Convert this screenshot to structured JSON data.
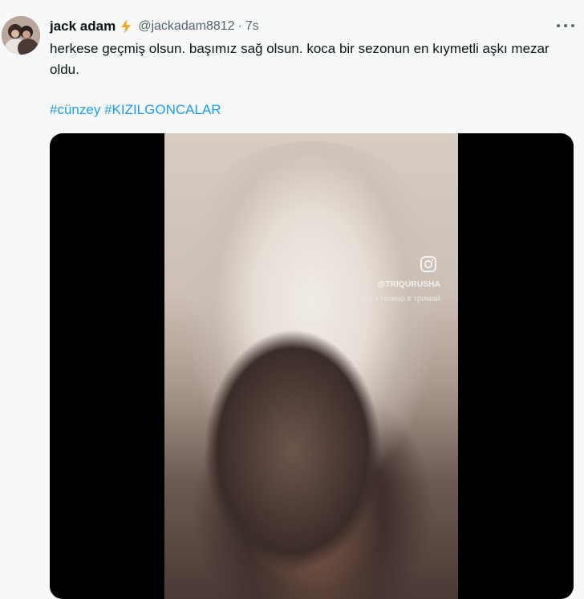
{
  "tweet": {
    "author_name": "jack adam",
    "handle": "@jackadam8812",
    "separator": "·",
    "time": "7s",
    "text": "herkese geçmiş olsun. başımız sağ olsun. koca bir sezonun en kıymetli aşkı mezar oldu.",
    "hashtags": [
      "#cünzey",
      "#KIZILGONCALAR"
    ]
  },
  "media": {
    "overlay_handle": "@TRIQURUSHA",
    "overlay_music": "ïoy • Нежно х тримай"
  },
  "icons": {
    "badge": "lightning-bolt-icon",
    "more": "more-options-icon",
    "overlay": "instagram-icon"
  },
  "colors": {
    "background": "#f7f9f9",
    "text": "#0f1419",
    "secondary": "#536471",
    "link": "#1d9bf0",
    "bolt": "#f4a522",
    "media_bg": "#000000"
  }
}
